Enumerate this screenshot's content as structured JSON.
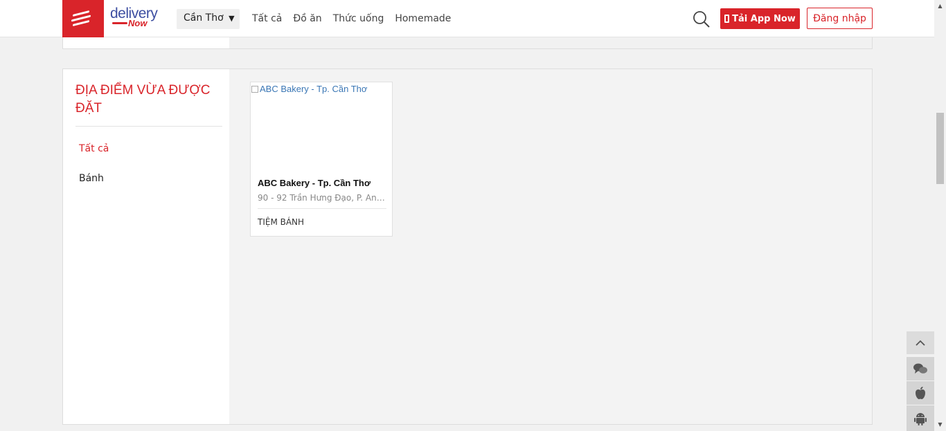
{
  "header": {
    "logo_text": "delivery",
    "logo_sub": "Now",
    "city": "Cần Thơ",
    "city_caret": "▼",
    "nav": [
      "Tất cả",
      "Đồ ăn",
      "Thức uống",
      "Homemade"
    ],
    "app_button": "Tải App Now",
    "login_button": "Đăng nhập"
  },
  "section": {
    "title": "ĐỊA ĐIỂM VỪA ĐƯỢC ĐẶT",
    "categories": [
      {
        "label": "Tất cả",
        "active": true
      },
      {
        "label": "Bánh",
        "active": false
      }
    ]
  },
  "card": {
    "image_alt": "ABC Bakery - Tp. Cần Thơ",
    "name": "ABC Bakery - Tp. Cần Thơ",
    "address": "90 - 92 Trần Hưng Đạo, P. An Nghiệp",
    "type": "TIỆM BÁNH"
  },
  "colors": {
    "brand_red": "#d9242a",
    "logo_blue": "#3d4ea1"
  },
  "icons": [
    "search-icon",
    "phone-icon",
    "chevron-up-icon",
    "chat-icon",
    "apple-icon",
    "android-icon"
  ]
}
